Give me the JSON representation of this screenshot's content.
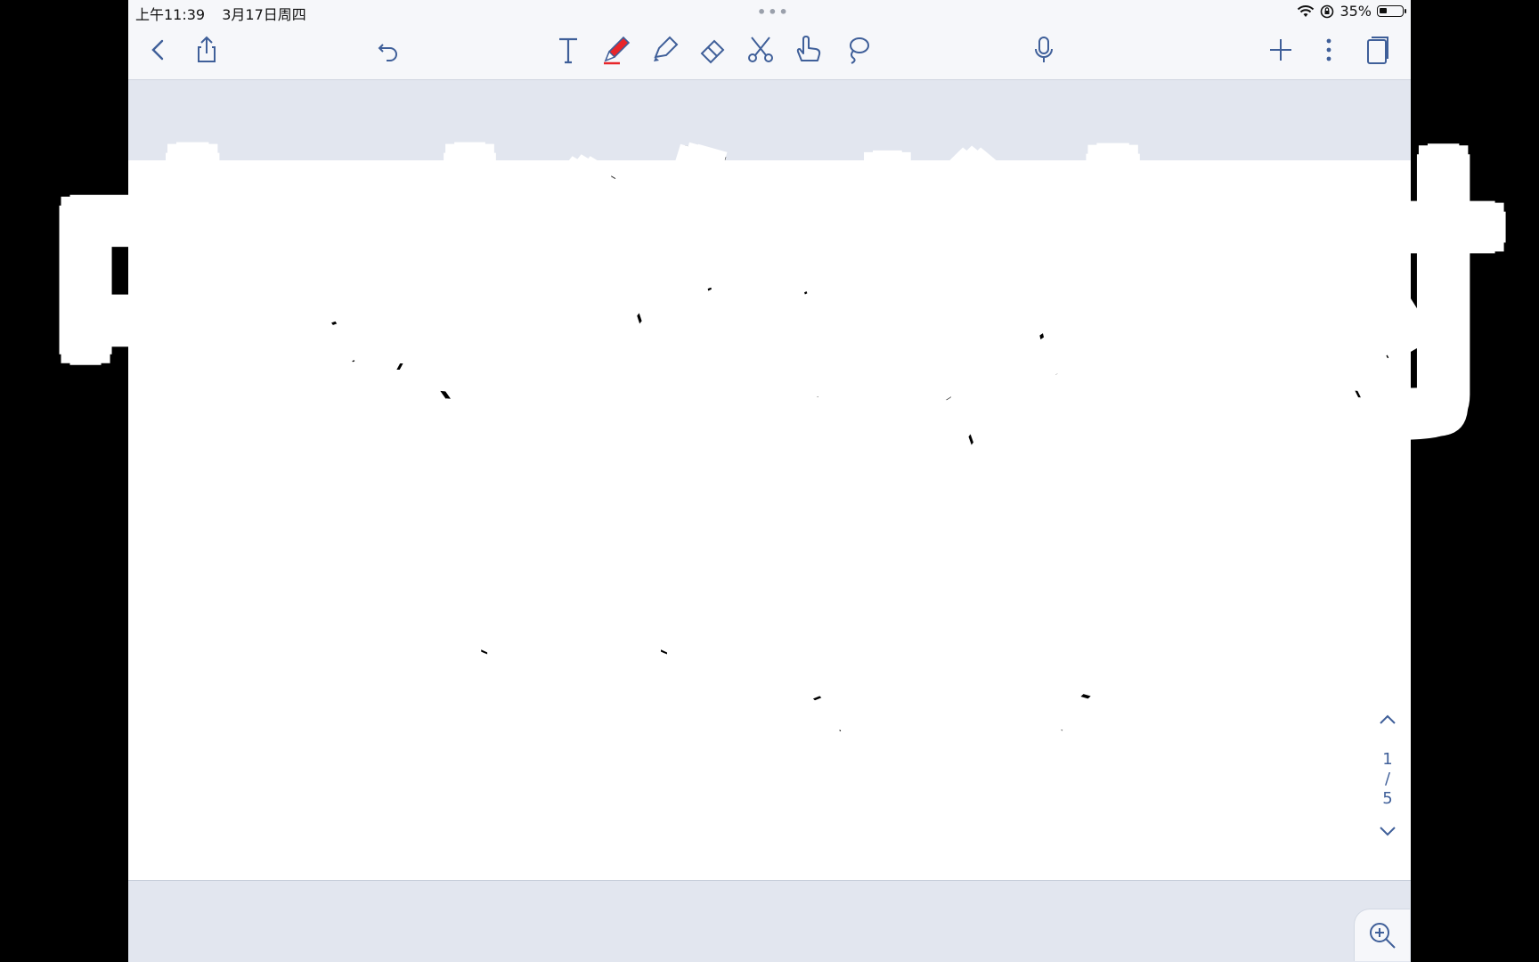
{
  "status_bar": {
    "time": "上午11:39",
    "date": "3月17日周四",
    "battery": "35%",
    "battery_level": 0.35
  },
  "toolbar": {
    "icons": [
      "back-icon",
      "share-icon",
      "undo-icon",
      "text-tool-icon",
      "pen-icon",
      "highlighter-icon",
      "eraser-icon",
      "scissors-icon",
      "hand-icon",
      "lasso-icon",
      "microphone-icon",
      "add-icon",
      "more-icon",
      "pages-icon"
    ],
    "pen_color": "#e8262a"
  },
  "overlay": {
    "title": "中考倒计时",
    "days": "99天"
  },
  "pager": {
    "current": "1",
    "separator": "/",
    "total": "5"
  },
  "colors": {
    "accent": "#3f5f99",
    "background": "#e2e6ef",
    "page": "#ffffff"
  }
}
